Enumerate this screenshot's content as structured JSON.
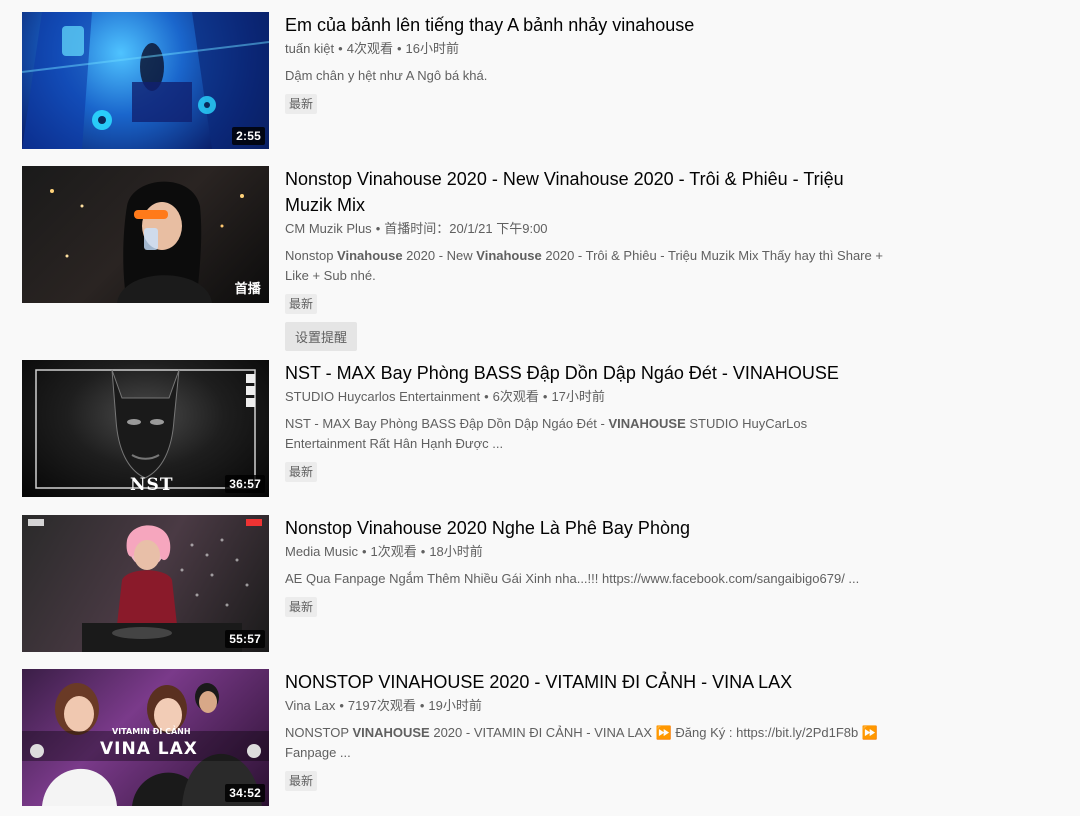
{
  "results": [
    {
      "title": "Em của bảnh lên tiếng thay A bảnh nhảy vinahouse",
      "channel": "tuấn kiệt",
      "views": "4次观看",
      "time": "16小时前",
      "description": "Dậm chân y hệt như A Ngô bá khá.",
      "badge": "最新",
      "duration": "2:55"
    },
    {
      "title": "Nonstop Vinahouse 2020 - New Vinahouse 2020 - Trôi & Phiêu - Triệu Muzik Mix",
      "channel": "CM Muzik Plus",
      "premiere": "首播时间：20/1/21 下午9:00",
      "description_parts": [
        "Nonstop ",
        "Vinahouse",
        " 2020 - New ",
        "Vinahouse",
        " 2020 - Trôi & Phiêu - Triệu Muzik Mix Thấy hay thì Share + Like + Sub nhé."
      ],
      "badge": "最新",
      "duration": "首播",
      "reminder": "设置提醒"
    },
    {
      "title": "NST - MAX Bay Phòng BASS Đập Dồn Dập Ngáo Đét - VINAHOUSE",
      "channel": "STUDIO Huycarlos Entertainment",
      "views": "6次观看",
      "time": "17小时前",
      "description_parts": [
        "NST - MAX Bay Phòng BASS Đập Dồn Dập Ngáo Đét - ",
        "VINAHOUSE",
        " STUDIO HuyCarLos Entertainment Rất Hân Hạnh Được ..."
      ],
      "badge": "最新",
      "duration": "36:57",
      "thumb_text": "NST"
    },
    {
      "title": "Nonstop Vinahouse 2020 Nghe Là Phê Bay Phòng",
      "channel": "Media Music",
      "views": "1次观看",
      "time": "18小时前",
      "description": "AE Qua Fanpage Ngắm Thêm Nhiều Gái Xinh nha...!!! https://www.facebook.com/sangaibigo679/ ...",
      "badge": "最新",
      "duration": "55:57"
    },
    {
      "title": "NONSTOP VINAHOUSE 2020 - VITAMIN ĐI CẢNH - VINA LAX",
      "channel": "Vina Lax",
      "views": "7197次观看",
      "time": "19小时前",
      "description_parts": [
        "NONSTOP ",
        "VINAHOUSE",
        " 2020 - VITAMIN ĐI CẢNH - VINA LAX ⏩ Đăng Ký : https://bit.ly/2Pd1F8b ⏩ Fanpage ..."
      ],
      "badge": "最新",
      "duration": "34:52",
      "thumb_text": "VINA LAX",
      "thumb_subtext": "VITAMIN ĐI CẢNH"
    }
  ]
}
